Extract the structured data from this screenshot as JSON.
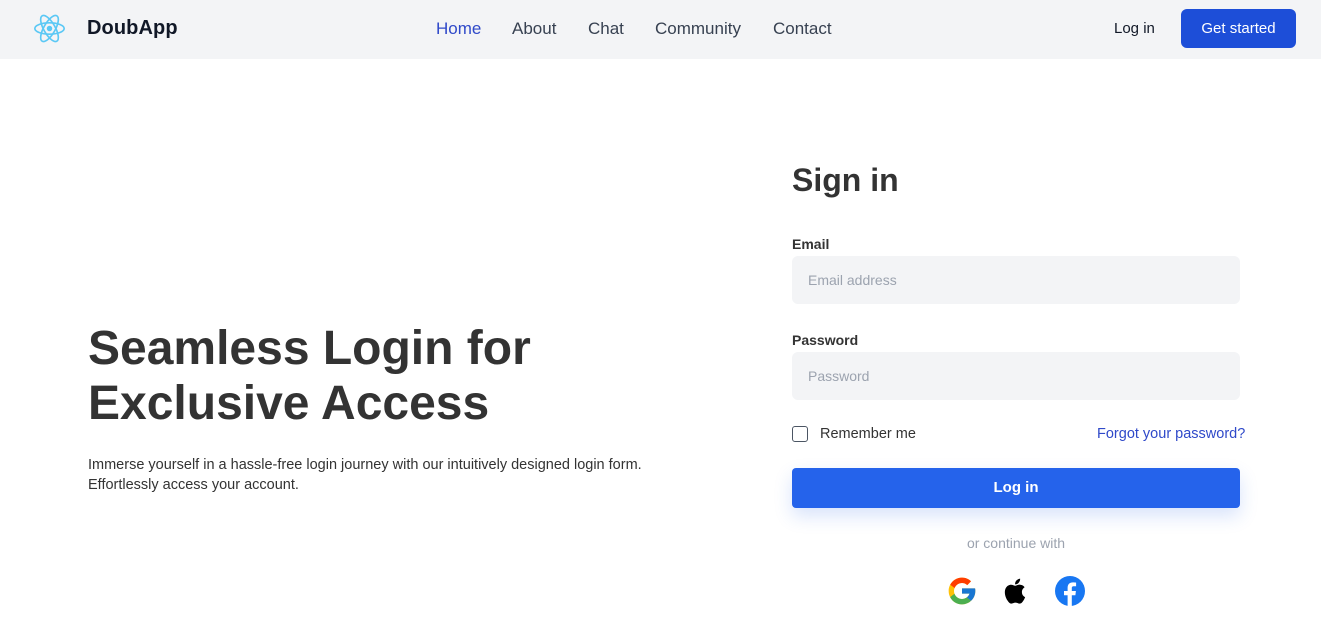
{
  "header": {
    "brand": "DoubApp",
    "logo_icon": "react-atom-icon",
    "nav": [
      {
        "label": "Home",
        "active": true
      },
      {
        "label": "About",
        "active": false
      },
      {
        "label": "Chat",
        "active": false
      },
      {
        "label": "Community",
        "active": false
      },
      {
        "label": "Contact",
        "active": false
      }
    ],
    "login_label": "Log in",
    "cta_label": "Get started"
  },
  "hero": {
    "title_line1": "Seamless Login for",
    "title_line2": "Exclusive Access",
    "description_line1": "Immerse yourself in a hassle-free login journey with our intuitively designed login form.",
    "description_line2": "Effortlessly access your account."
  },
  "form": {
    "title": "Sign in",
    "email": {
      "label": "Email",
      "placeholder": "Email address",
      "value": ""
    },
    "password": {
      "label": "Password",
      "placeholder": "Password",
      "value": ""
    },
    "remember_label": "Remember me",
    "remember_checked": false,
    "forgot_label": "Forgot your password?",
    "submit_label": "Log in",
    "continue_text": "or continue with",
    "social": [
      "google-icon",
      "apple-icon",
      "facebook-icon"
    ]
  },
  "colors": {
    "accent": "#2563eb",
    "nav_active": "#2f49c9",
    "header_bg": "#f3f4f6",
    "cta_bg": "#1d4ed8",
    "input_bg": "#f3f4f6"
  }
}
